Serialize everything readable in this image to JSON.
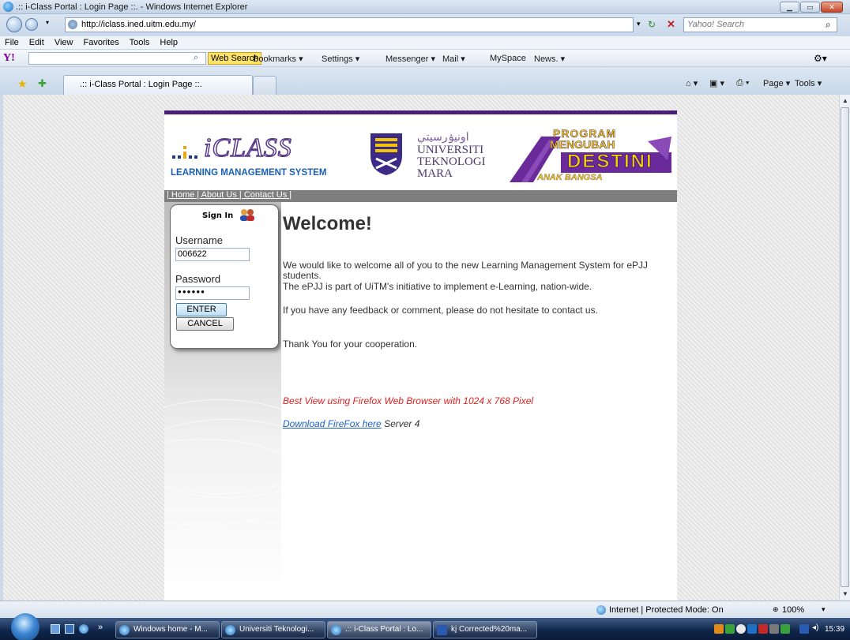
{
  "window": {
    "title": ".:: i-Class Portal : Login Page ::. - Windows Internet Explorer"
  },
  "address_bar": {
    "url": "http://iclass.ined.uitm.edu.my/",
    "search_placeholder": "Yahoo! Search"
  },
  "menu": [
    "File",
    "Edit",
    "View",
    "Favorites",
    "Tools",
    "Help"
  ],
  "yahoo_toolbar": {
    "logo": "Y!",
    "web_search": "Web Search",
    "items": [
      "Bookmarks ▾",
      "Settings ▾",
      "Messenger ▾",
      "Mail ▾",
      "MySpace",
      "News. ▾"
    ]
  },
  "tabs": {
    "active_tab": ".:: i-Class Portal : Login Page ::.",
    "commands": [
      "Page ▾",
      "Tools ▾"
    ]
  },
  "page": {
    "logo": {
      "brand": "iCLASS",
      "tagline": "LEARNING MANAGEMENT SYSTEM"
    },
    "university": {
      "jawi": "اونيۏرسيتي",
      "line1": "UNIVERSITI",
      "line2": "TEKNOLOGI",
      "line3": "MARA"
    },
    "banner": {
      "line1": "PROGRAM",
      "line2": "MENGUBAH",
      "line3": "DESTINI",
      "line4": "ANAK BANGSA"
    },
    "nav": "| Home | About Us | Contact Us |",
    "login": {
      "title": "Sign In",
      "username_label": "Username",
      "username_value": "006622",
      "password_label": "Password",
      "password_value": "●●●●●●",
      "enter": "ENTER",
      "cancel": "CANCEL"
    },
    "welcome": {
      "heading": "Welcome!",
      "p1": "We would like to welcome all of you to the new Learning Management System for ePJJ students.",
      "p2": "The ePJJ is part of UiTM's initiative to implement e-Learning, nation-wide.",
      "p3": "If you have any feedback or comment, please do not hesitate to contact us.",
      "p4": "Thank You for your cooperation.",
      "best_view": "Best View using Firefox Web Browser with 1024 x 768 Pixel",
      "download_link": "Download FireFox here",
      "server": "Server 4"
    }
  },
  "status_bar": {
    "zone": "Internet | Protected Mode: On",
    "zoom": "100%"
  },
  "taskbar": {
    "tasks": [
      "Windows home - M...",
      "Universiti Teknologi...",
      ".:: i-Class Portal : Lo...",
      "kj Corrected%20ma..."
    ],
    "clock": "15:39"
  },
  "colors": {
    "accent_purple": "#4a1d78",
    "link_blue": "#1a5fc8",
    "best_view_red": "#e02020"
  }
}
